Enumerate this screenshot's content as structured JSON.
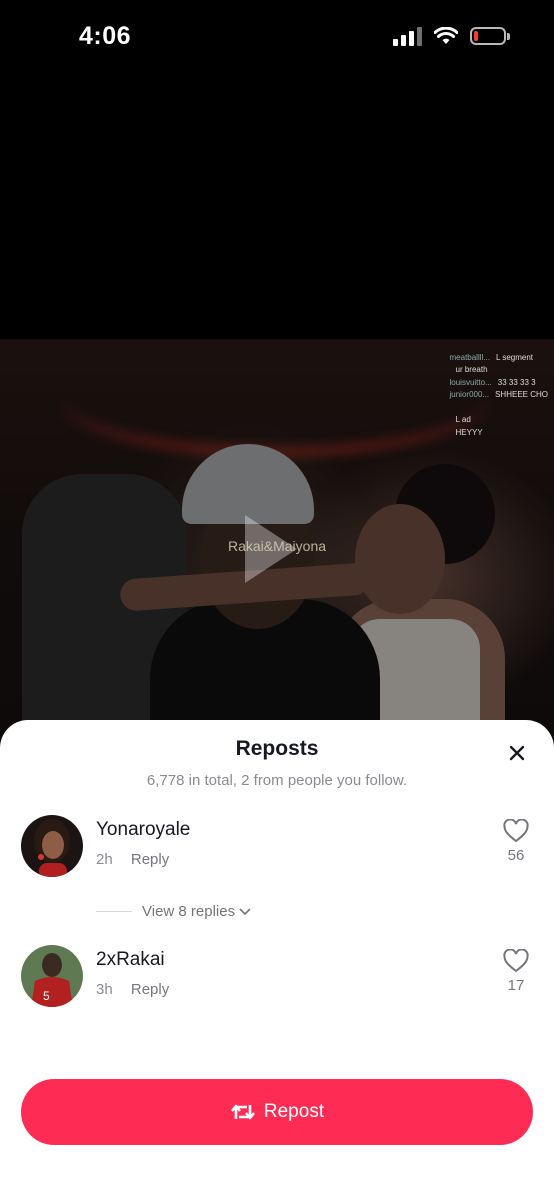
{
  "status_bar": {
    "time": "4:06",
    "battery_level": 0.1
  },
  "video": {
    "watermark": "Rakai&Maiyona",
    "chat": [
      {
        "user": "",
        "msg": ""
      },
      {
        "user": "meatballll...",
        "msg": "L segment"
      },
      {
        "user": "",
        "msg": "ur breath"
      },
      {
        "user": "louisvuitto...",
        "msg": "33 33 33 3"
      },
      {
        "user": "junior000...",
        "msg": "SHHEEE CHO"
      },
      {
        "user": "",
        "msg": ""
      },
      {
        "user": "",
        "msg": "L ad"
      },
      {
        "user": "",
        "msg": "HEYYY"
      }
    ]
  },
  "sheet": {
    "title": "Reposts",
    "subtitle": "6,778 in total, 2 from people you follow.",
    "items": [
      {
        "username": "Yonaroyale",
        "time": "2h",
        "reply_label": "Reply",
        "likes": "56"
      },
      {
        "username": "2xRakai",
        "time": "3h",
        "reply_label": "Reply",
        "likes": "17"
      }
    ],
    "view_replies": "View 8 replies",
    "repost_label": "Repost"
  },
  "colors": {
    "accent": "#fe2c55",
    "text": "#161823",
    "secondary": "#8a8b91"
  }
}
